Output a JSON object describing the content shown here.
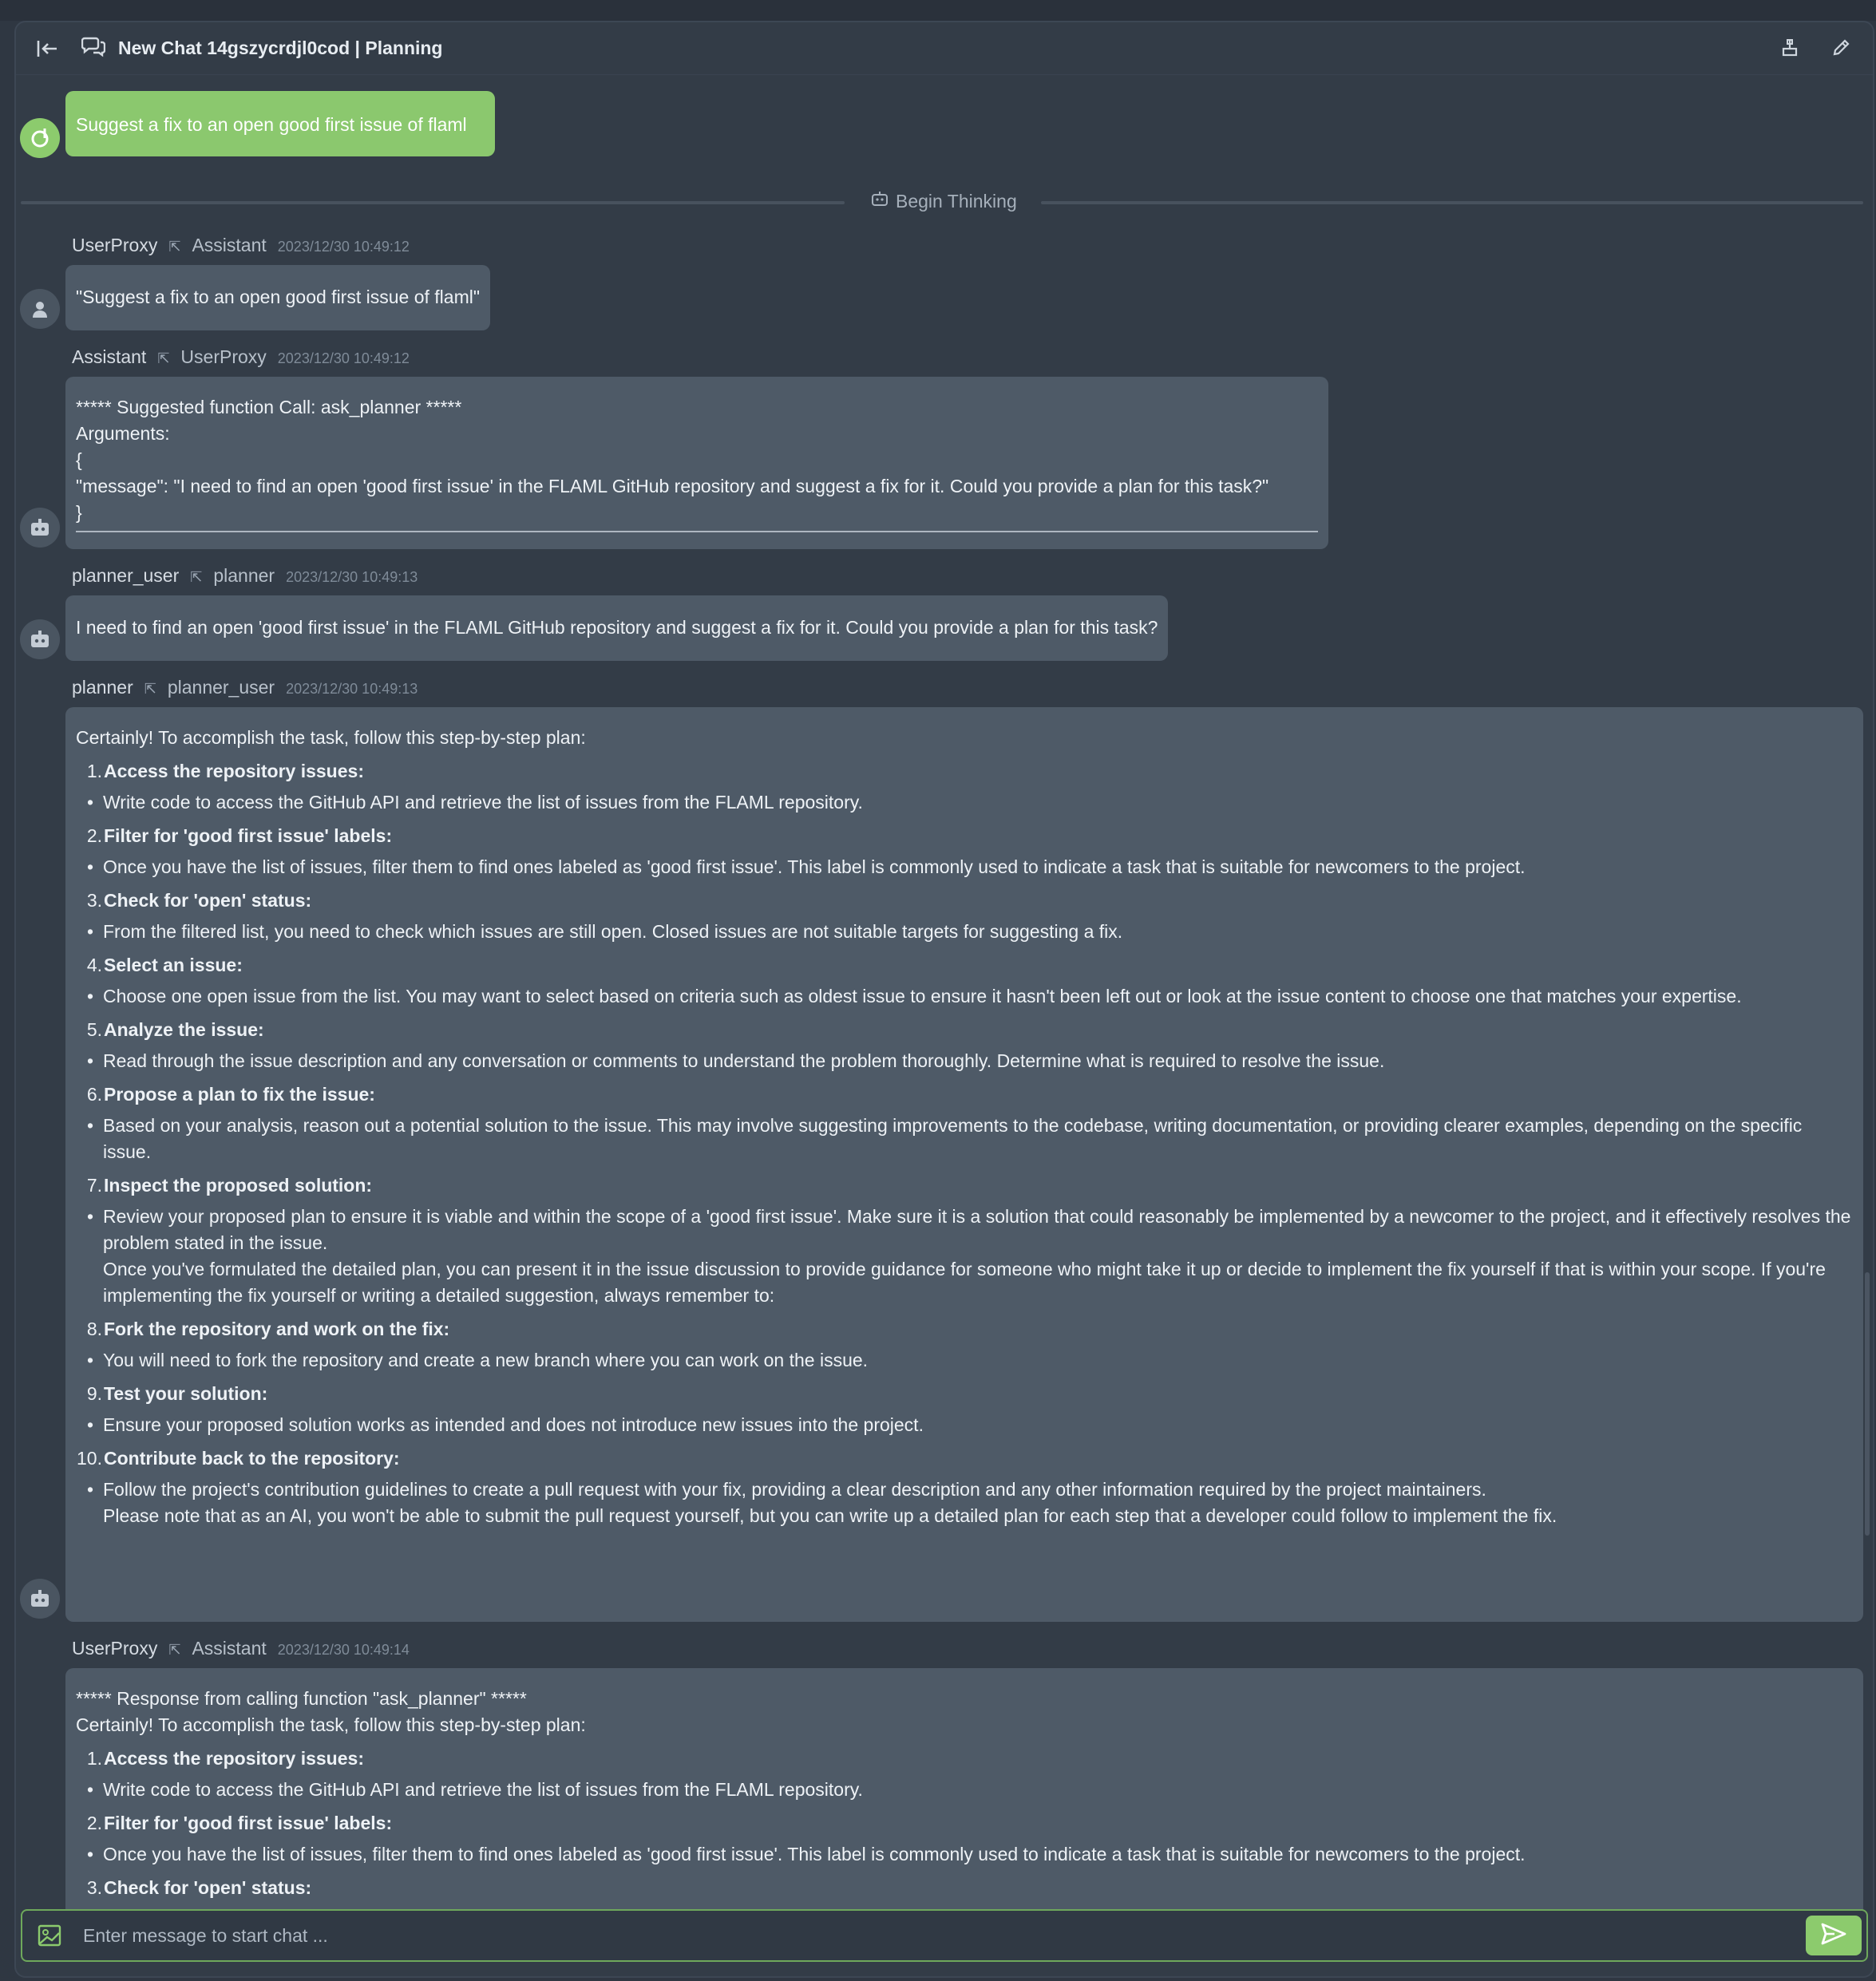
{
  "header": {
    "title": "New Chat 14gszycrdjl0cod | Planning",
    "back_icon": "collapse-left-icon",
    "chat_icon": "chat-bubbles-icon",
    "share_icon": "share-icon",
    "edit_icon": "edit-pencil-icon"
  },
  "user_prompt": "Suggest a fix to an open good first issue of flaml",
  "divider_label": "Begin Thinking",
  "messages": [
    {
      "from": "UserProxy",
      "to": "Assistant",
      "time": "2023/12/30 10:49:12",
      "text": "\"Suggest a fix to an open good first issue of flaml\""
    },
    {
      "from": "Assistant",
      "to": "UserProxy",
      "time": "2023/12/30 10:49:12",
      "lines": [
        "***** Suggested function Call: ask_planner *****",
        "Arguments:",
        "{",
        "\"message\": \"I need to find an open 'good first issue' in the FLAML GitHub repository and suggest a fix for it. Could you provide a plan for this task?\"",
        "}"
      ]
    },
    {
      "from": "planner_user",
      "to": "planner",
      "time": "2023/12/30 10:49:13",
      "text": "I need to find an open 'good first issue' in the FLAML GitHub repository and suggest a fix for it. Could you provide a plan for this task?"
    },
    {
      "from": "planner",
      "to": "planner_user",
      "time": "2023/12/30 10:49:13",
      "intro": "Certainly! To accomplish the task, follow this step-by-step plan:",
      "steps": [
        {
          "n": "1.",
          "title": "Access the repository issues:",
          "bullet": "Write code to access the GitHub API and retrieve the list of issues from the FLAML repository."
        },
        {
          "n": "2.",
          "title": "Filter for 'good first issue' labels:",
          "bullet": "Once you have the list of issues, filter them to find ones labeled as 'good first issue'. This label is commonly used to indicate a task that is suitable for newcomers to the project."
        },
        {
          "n": "3.",
          "title": "Check for 'open' status:",
          "bullet": "From the filtered list, you need to check which issues are still open. Closed issues are not suitable targets for suggesting a fix."
        },
        {
          "n": "4.",
          "title": "Select an issue:",
          "bullet": "Choose one open issue from the list. You may want to select based on criteria such as oldest issue to ensure it hasn't been left out or look at the issue content to choose one that matches your expertise."
        },
        {
          "n": "5.",
          "title": "Analyze the issue:",
          "bullet": "Read through the issue description and any conversation or comments to understand the problem thoroughly. Determine what is required to resolve the issue."
        },
        {
          "n": "6.",
          "title": "Propose a plan to fix the issue:",
          "bullet": "Based on your analysis, reason out a potential solution to the issue. This may involve suggesting improvements to the codebase, writing documentation, or providing clearer examples, depending on the specific issue."
        },
        {
          "n": "7.",
          "title": "Inspect the proposed solution:",
          "bullet": "Review your proposed plan to ensure it is viable and within the scope of a 'good first issue'. Make sure it is a solution that could reasonably be implemented by a newcomer to the project, and it effectively resolves the problem stated in the issue.",
          "extra": "Once you've formulated the detailed plan, you can present it in the issue discussion to provide guidance for someone who might take it up or decide to implement the fix yourself if that is within your scope. If you're implementing the fix yourself or writing a detailed suggestion, always remember to:"
        },
        {
          "n": "8.",
          "title": "Fork the repository and work on the fix:",
          "bullet": "You will need to fork the repository and create a new branch where you can work on the issue."
        },
        {
          "n": "9.",
          "title": "Test your solution:",
          "bullet": "Ensure your proposed solution works as intended and does not introduce new issues into the project."
        },
        {
          "n": "10.",
          "title": "Contribute back to the repository:",
          "bullet": "Follow the project's contribution guidelines to create a pull request with your fix, providing a clear description and any other information required by the project maintainers.",
          "extra": "Please note that as an AI, you won't be able to submit the pull request yourself, but you can write up a detailed plan for each step that a developer could follow to implement the fix."
        }
      ]
    },
    {
      "from": "UserProxy",
      "to": "Assistant",
      "time": "2023/12/30 10:49:14",
      "header_line": "***** Response from calling function \"ask_planner\" *****",
      "intro": "Certainly! To accomplish the task, follow this step-by-step plan:",
      "steps": [
        {
          "n": "1.",
          "title": "Access the repository issues:",
          "bullet": "Write code to access the GitHub API and retrieve the list of issues from the FLAML repository."
        },
        {
          "n": "2.",
          "title": "Filter for 'good first issue' labels:",
          "bullet": "Once you have the list of issues, filter them to find ones labeled as 'good first issue'. This label is commonly used to indicate a task that is suitable for newcomers to the project."
        },
        {
          "n": "3.",
          "title": "Check for 'open' status:"
        }
      ]
    }
  ],
  "input": {
    "placeholder": "Enter message to start chat ...",
    "image_icon": "image-upload-icon",
    "send_icon": "send-icon"
  },
  "colors": {
    "accent": "#8ccb6d",
    "bubble": "#4e5a67",
    "background": "#333c47"
  }
}
